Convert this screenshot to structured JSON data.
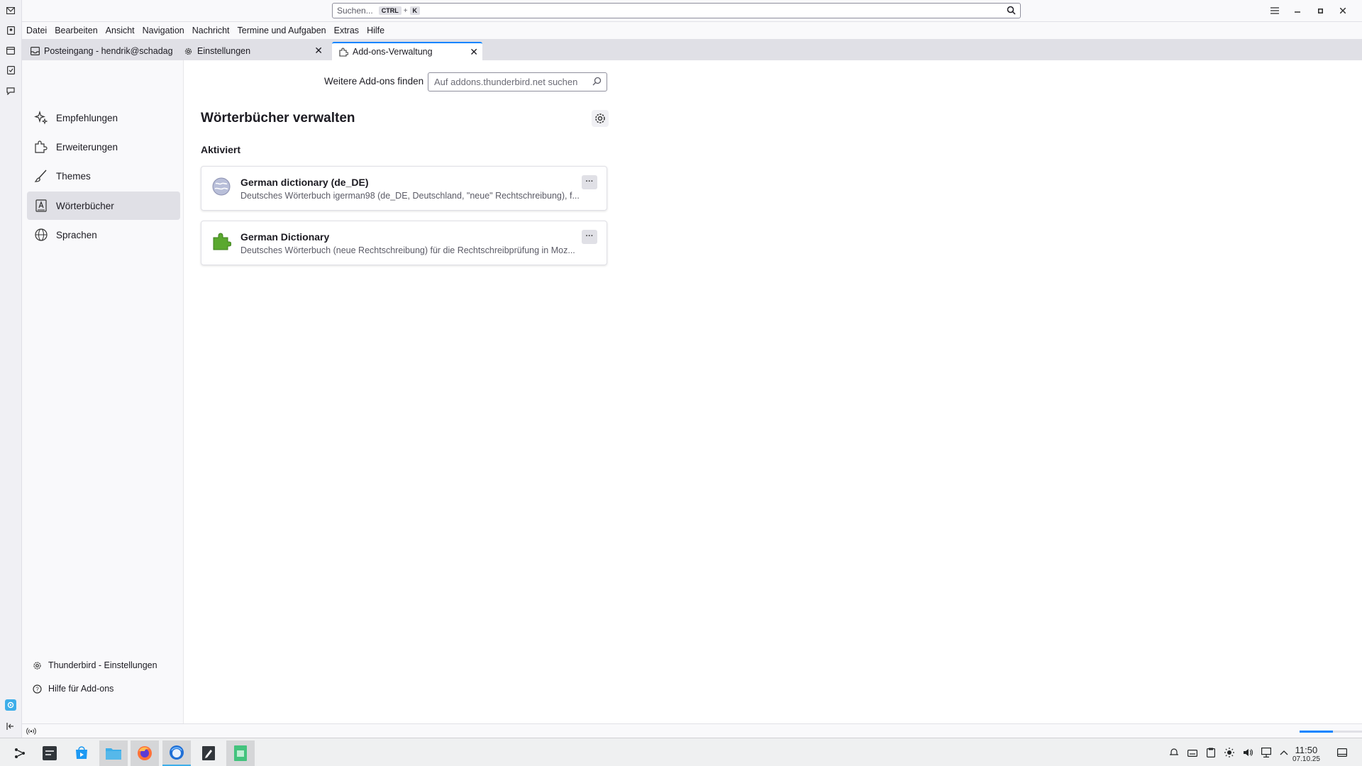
{
  "search": {
    "placeholder": "Suchen...",
    "shortcut_key1": "CTRL",
    "shortcut_plus": "+",
    "shortcut_key2": "K"
  },
  "menubar": [
    "Datei",
    "Bearbeiten",
    "Ansicht",
    "Navigation",
    "Nachricht",
    "Termine und Aufgaben",
    "Extras",
    "Hilfe"
  ],
  "tabs": [
    {
      "label": "Posteingang - hendrik@schadagi",
      "icon": "inbox-icon"
    },
    {
      "label": "Einstellungen",
      "icon": "gear-icon"
    },
    {
      "label": "Add-ons-Verwaltung",
      "icon": "puzzle-icon"
    }
  ],
  "sidebar": {
    "items": [
      {
        "label": "Empfehlungen",
        "icon": "sparkle-icon"
      },
      {
        "label": "Erweiterungen",
        "icon": "puzzle-icon"
      },
      {
        "label": "Themes",
        "icon": "brush-icon"
      },
      {
        "label": "Wörterbücher",
        "icon": "dictionary-icon"
      },
      {
        "label": "Sprachen",
        "icon": "globe-icon"
      }
    ],
    "footer": {
      "settings_label": "Thunderbird - Einstellungen",
      "help_label": "Hilfe für Add-ons"
    }
  },
  "main": {
    "find_label": "Weitere Add-ons finden",
    "find_placeholder": "Auf addons.thunderbird.net suchen",
    "heading": "Wörterbücher verwalten",
    "section_label": "Aktiviert",
    "addons": [
      {
        "name": "German dictionary (de_DE)",
        "description": "Deutsches Wörterbuch igerman98 (de_DE, Deutschland, \"neue\" Rechtschreibung), f...",
        "icon": "globe-dictionary-icon"
      },
      {
        "name": "German Dictionary",
        "description": "Deutsches Wörterbuch (neue Rechtschreibung) für die Rechtschreibprüfung in Moz...",
        "icon": "green-puzzle-icon"
      }
    ],
    "more_label": "···"
  },
  "statusbar": {
    "progress": 0.4
  },
  "taskbar": {
    "time": "11:50",
    "date": "07.10.25"
  },
  "colors": {
    "accent": "#0a84ff",
    "selected": "#e0e0e6"
  }
}
